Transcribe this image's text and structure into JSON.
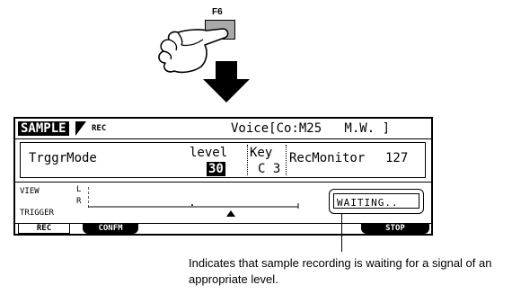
{
  "function_key": {
    "label": "F6"
  },
  "screen": {
    "tab_active": "SAMPLE",
    "tab_sub": "REC",
    "title": "Voice[Co:M25   M.W. ]",
    "params": {
      "trigger_mode_label": "TrggrMode",
      "level_label": "level",
      "level_value": "30",
      "key_label": "Key",
      "key_value": "C 3",
      "rec_monitor_label": "RecMonitor",
      "rec_monitor_value": "127"
    },
    "meter": {
      "view_label": "VIEW",
      "channel_left": "L",
      "channel_right": "R",
      "trigger_label": "TRIGGER"
    },
    "status": "WAITING..",
    "buttons": {
      "rec": "REC",
      "confirm": "CONFM",
      "stop": "STOP"
    }
  },
  "callout": "Indicates that sample recording is waiting for a signal of an appropriate level."
}
